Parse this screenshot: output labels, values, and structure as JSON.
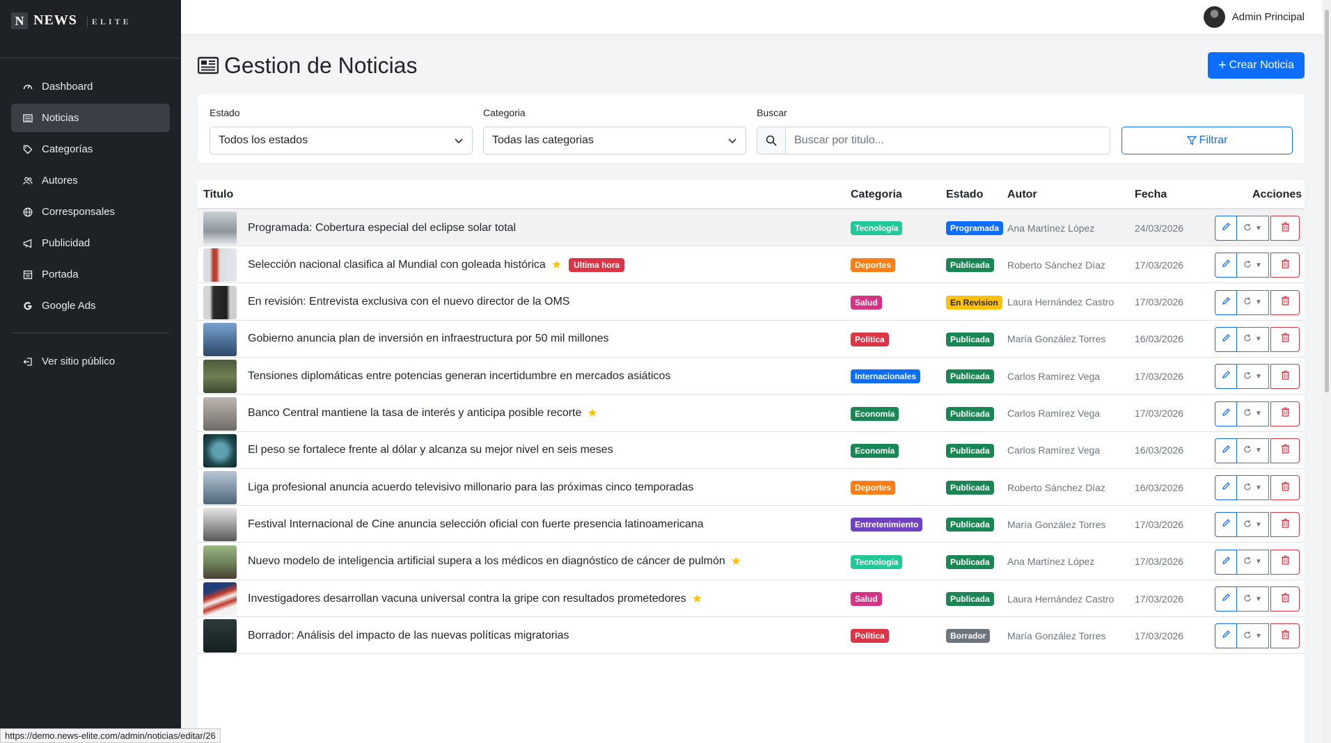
{
  "brand": {
    "n": "N",
    "news": "NEWS",
    "elite": "ELITE"
  },
  "sidebar": {
    "items": [
      {
        "label": "Dashboard",
        "icon": "dashboard-icon"
      },
      {
        "label": "Noticias",
        "icon": "newspaper-icon",
        "active": true
      },
      {
        "label": "Categorías",
        "icon": "tags-icon"
      },
      {
        "label": "Autores",
        "icon": "people-icon"
      },
      {
        "label": "Corresponsales",
        "icon": "globe-icon"
      },
      {
        "label": "Publicidad",
        "icon": "megaphone-icon"
      },
      {
        "label": "Portada",
        "icon": "layout-icon"
      },
      {
        "label": "Google Ads",
        "icon": "google-icon"
      }
    ],
    "public_link": "Ver sitio público"
  },
  "topbar": {
    "user_name": "Admin Principal"
  },
  "page": {
    "title": "Gestion de Noticias",
    "create_button": "Crear Noticia"
  },
  "filters": {
    "estado_label": "Estado",
    "estado_value": "Todos los estados",
    "categoria_label": "Categoria",
    "categoria_value": "Todas las categorias",
    "buscar_label": "Buscar",
    "buscar_placeholder": "Buscar por titulo...",
    "filter_button": "Filtrar"
  },
  "table": {
    "headers": [
      "Titulo",
      "Categoria",
      "Estado",
      "Autor",
      "Fecha",
      "Acciones"
    ],
    "rows": [
      {
        "title": "Programada: Cobertura especial del eclipse solar total",
        "star": false,
        "urgent": "",
        "category": "Tecnología",
        "status": "Programada",
        "author": "Ana Martínez López",
        "date": "24/03/2026"
      },
      {
        "title": "Selección nacional clasifica al Mundial con goleada histórica",
        "star": true,
        "urgent": "Ultima hora",
        "category": "Deportes",
        "status": "Publicada",
        "author": "Roberto Sánchez Díaz",
        "date": "17/03/2026"
      },
      {
        "title": "En revisión: Entrevista exclusiva con el nuevo director de la OMS",
        "star": false,
        "urgent": "",
        "category": "Salud",
        "status": "En Revision",
        "author": "Laura Hernández Castro",
        "date": "17/03/2026"
      },
      {
        "title": "Gobierno anuncia plan de inversión en infraestructura por 50 mil millones",
        "star": false,
        "urgent": "",
        "category": "Política",
        "status": "Publicada",
        "author": "María González Torres",
        "date": "16/03/2026"
      },
      {
        "title": "Tensiones diplomáticas entre potencias generan incertidumbre en mercados asiáticos",
        "star": false,
        "urgent": "",
        "category": "Internacionales",
        "status": "Publicada",
        "author": "Carlos Ramírez Vega",
        "date": "17/03/2026"
      },
      {
        "title": "Banco Central mantiene la tasa de interés y anticipa posible recorte",
        "star": true,
        "urgent": "",
        "category": "Economía",
        "status": "Publicada",
        "author": "Carlos Ramírez Vega",
        "date": "17/03/2026"
      },
      {
        "title": "El peso se fortalece frente al dólar y alcanza su mejor nivel en seis meses",
        "star": false,
        "urgent": "",
        "category": "Economía",
        "status": "Publicada",
        "author": "Carlos Ramírez Vega",
        "date": "16/03/2026"
      },
      {
        "title": "Liga profesional anuncia acuerdo televisivo millonario para las próximas cinco temporadas",
        "star": false,
        "urgent": "",
        "category": "Deportes",
        "status": "Publicada",
        "author": "Roberto Sánchez Díaz",
        "date": "16/03/2026"
      },
      {
        "title": "Festival Internacional de Cine anuncia selección oficial con fuerte presencia latinoamericana",
        "star": false,
        "urgent": "",
        "category": "Entretenimiento",
        "status": "Publicada",
        "author": "María González Torres",
        "date": "17/03/2026"
      },
      {
        "title": "Nuevo modelo de inteligencia artificial supera a los médicos en diagnóstico de cáncer de pulmón",
        "star": true,
        "urgent": "",
        "category": "Tecnología",
        "status": "Publicada",
        "author": "Ana Martínez López",
        "date": "17/03/2026"
      },
      {
        "title": "Investigadores desarrollan vacuna universal contra la gripe con resultados prometedores",
        "star": true,
        "urgent": "",
        "category": "Salud",
        "status": "Publicada",
        "author": "Laura Hernández Castro",
        "date": "17/03/2026"
      },
      {
        "title": "Borrador: Análisis del impacto de las nuevas políticas migratorias",
        "star": false,
        "urgent": "",
        "category": "Política",
        "status": "Borrador",
        "author": "María González Torres",
        "date": "17/03/2026"
      }
    ]
  },
  "category_colors": {
    "Tecnología": "#20c997",
    "Deportes": "#fd7e14",
    "Salud": "#d63384",
    "Política": "#dc3545",
    "Internacionales": "#0d6efd",
    "Economía": "#198754",
    "Entretenimiento": "#6f42c1"
  },
  "status_colors": {
    "Programada": "#0d6efd",
    "Publicada": "#198754",
    "En Revision": "#ffc107",
    "Borrador": "#6c757d"
  },
  "statusbar": {
    "url": "https://demo.news-elite.com/admin/noticias/editar/26"
  }
}
